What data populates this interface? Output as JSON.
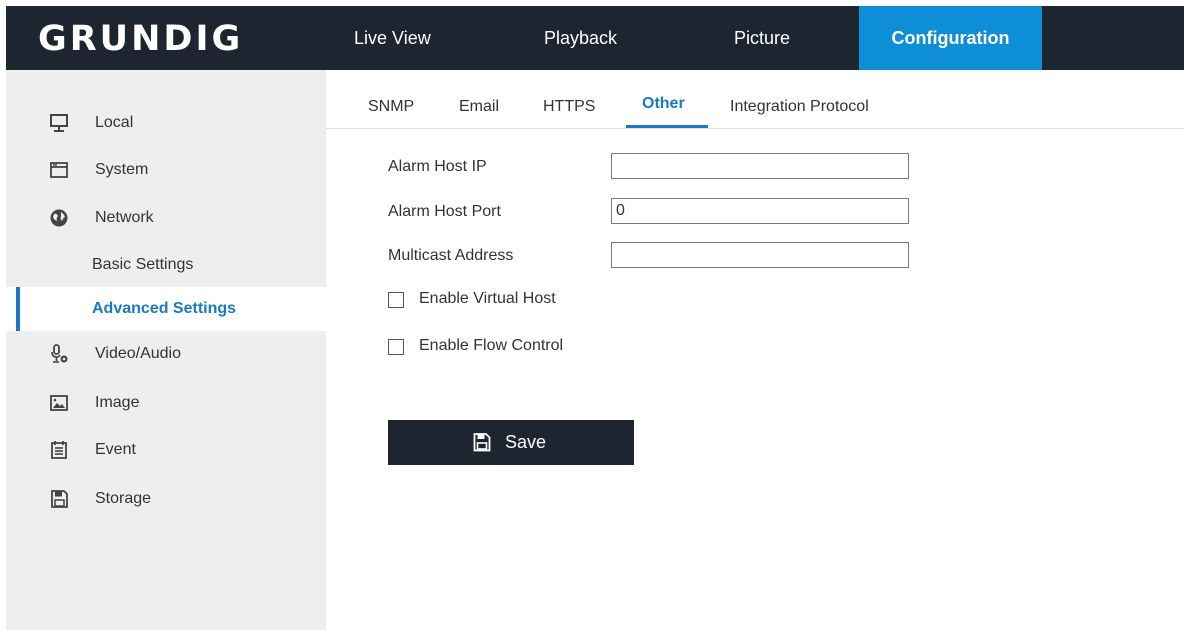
{
  "header": {
    "logo": "GRUNDIG",
    "nav": [
      {
        "label": "Live View"
      },
      {
        "label": "Playback"
      },
      {
        "label": "Picture"
      },
      {
        "label": "Configuration",
        "active": true
      }
    ]
  },
  "sidebar": {
    "items": [
      {
        "label": "Local",
        "icon": "monitor-icon"
      },
      {
        "label": "System",
        "icon": "window-icon"
      },
      {
        "label": "Network",
        "icon": "globe-icon"
      },
      {
        "label": "Basic Settings"
      },
      {
        "label": "Advanced Settings",
        "active": true
      },
      {
        "label": "Video/Audio",
        "icon": "microphone-icon"
      },
      {
        "label": "Image",
        "icon": "image-icon"
      },
      {
        "label": "Event",
        "icon": "calendar-icon"
      },
      {
        "label": "Storage",
        "icon": "floppy-icon"
      }
    ]
  },
  "subtabs": [
    {
      "label": "SNMP"
    },
    {
      "label": "Email"
    },
    {
      "label": "HTTPS"
    },
    {
      "label": "Other",
      "active": true
    },
    {
      "label": "Integration Protocol"
    }
  ],
  "form": {
    "alarm_host_ip": {
      "label": "Alarm Host IP",
      "value": ""
    },
    "alarm_host_port": {
      "label": "Alarm Host Port",
      "value": "0"
    },
    "multicast_address": {
      "label": "Multicast Address",
      "value": ""
    },
    "enable_virtual_host": {
      "label": "Enable Virtual Host",
      "checked": false
    },
    "enable_flow_control": {
      "label": "Enable Flow Control",
      "checked": false
    }
  },
  "save_button": {
    "label": "Save",
    "icon": "floppy-icon"
  },
  "colors": {
    "header_bg": "#1c2530",
    "accent": "#0e8ed6",
    "link_blue": "#1a79c2",
    "sidebar_bg": "#eeeeee"
  }
}
